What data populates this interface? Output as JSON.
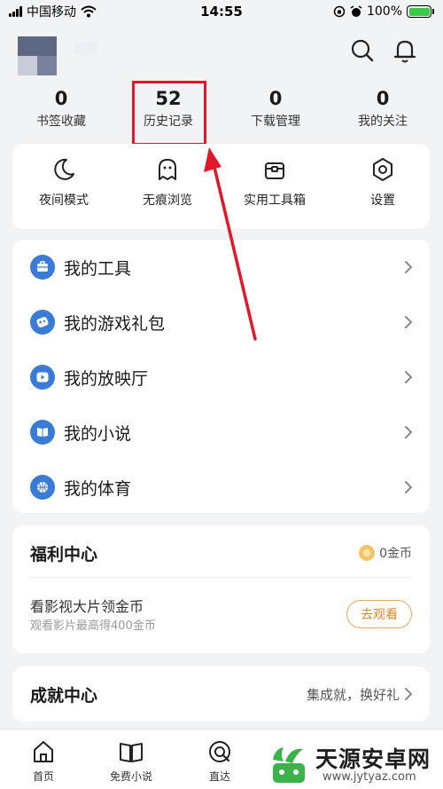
{
  "status_bar": {
    "carrier": "中国移动",
    "time": "14:55",
    "battery": "100%"
  },
  "header": {
    "icons": [
      "search-icon",
      "bell-icon"
    ]
  },
  "stats": [
    {
      "value": "0",
      "label": "书签收藏"
    },
    {
      "value": "52",
      "label": "历史记录"
    },
    {
      "value": "0",
      "label": "下载管理"
    },
    {
      "value": "0",
      "label": "我的关注"
    }
  ],
  "quick_actions": [
    {
      "label": "夜间模式",
      "icon": "moon-icon"
    },
    {
      "label": "无痕浏览",
      "icon": "ghost-icon"
    },
    {
      "label": "实用工具箱",
      "icon": "toolbox-icon"
    },
    {
      "label": "设置",
      "icon": "settings-icon"
    }
  ],
  "menu": [
    {
      "label": "我的工具",
      "icon": "toolbox-icon"
    },
    {
      "label": "我的游戏礼包",
      "icon": "gamepad-icon"
    },
    {
      "label": "我的放映厅",
      "icon": "play-icon"
    },
    {
      "label": "我的小说",
      "icon": "book-icon"
    },
    {
      "label": "我的体育",
      "icon": "basketball-icon"
    }
  ],
  "welfare": {
    "title": "福利中心",
    "coins": "0金币",
    "task_title": "看影视大片领金币",
    "task_desc": "观看影片最高得400金币",
    "button": "去观看"
  },
  "achievement": {
    "title": "成就中心",
    "link": "集成就，换好礼"
  },
  "tabs": [
    {
      "label": "首页",
      "icon": "home-icon"
    },
    {
      "label": "免费小说",
      "icon": "open-book-icon"
    },
    {
      "label": "直达",
      "icon": "compass-icon"
    }
  ],
  "watermark": {
    "name": "天源安卓网",
    "url": "www.jytyaz.com"
  },
  "colors": {
    "accent_blue": "#3a7bd5",
    "highlight_red": "#e0182a",
    "coin_orange": "#d98a2a"
  }
}
